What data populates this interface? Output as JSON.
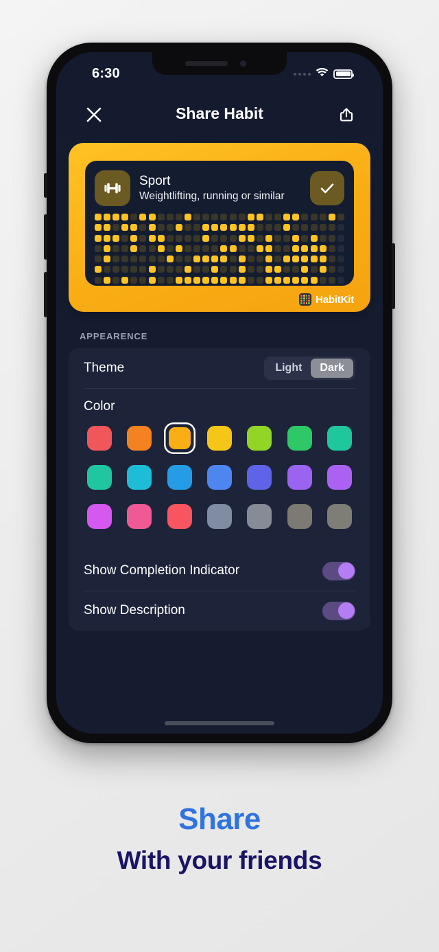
{
  "page": {
    "background_color": "#ededed"
  },
  "caption": {
    "line1": "Share",
    "line1_color": "#2f73e0",
    "line2": "With your friends",
    "line2_color": "#1a1466"
  },
  "phone": {
    "status_bar": {
      "time": "6:30",
      "signal_icon": "signal-dots-icon",
      "wifi_icon": "wifi-icon",
      "battery_icon": "battery-icon"
    },
    "nav_bar": {
      "close_icon": "close-icon",
      "title": "Share Habit",
      "share_icon": "share-icon"
    }
  },
  "preview_card": {
    "card_color": "#f9ad14",
    "habit": {
      "icon": "dumbbell-icon",
      "name": "Sport",
      "description": "Weightlifting, running or similar",
      "completion_icon": "checkmark-icon",
      "icon_bg": "#6b5a22",
      "grid_active_color": "#ffc420",
      "grid_inactive_color": "#39372a",
      "grid_rows": 7,
      "grid_columns": 28,
      "grid": [
        [
          1,
          1,
          1,
          1,
          0,
          1,
          1,
          0,
          0,
          0,
          1,
          0,
          0,
          0,
          0,
          0,
          0,
          1,
          1,
          0,
          0,
          1,
          1,
          0,
          0,
          0,
          1,
          0
        ],
        [
          1,
          1,
          0,
          1,
          1,
          0,
          1,
          0,
          0,
          1,
          0,
          0,
          1,
          1,
          1,
          1,
          1,
          1,
          0,
          0,
          0,
          1,
          0,
          0,
          0,
          0,
          0,
          0
        ],
        [
          1,
          1,
          1,
          0,
          1,
          0,
          1,
          1,
          0,
          0,
          0,
          0,
          1,
          0,
          0,
          0,
          1,
          1,
          0,
          1,
          0,
          0,
          1,
          0,
          1,
          0,
          0,
          0
        ],
        [
          0,
          1,
          0,
          0,
          1,
          0,
          0,
          1,
          0,
          1,
          0,
          0,
          0,
          0,
          1,
          1,
          0,
          0,
          1,
          1,
          0,
          0,
          1,
          1,
          1,
          1,
          0,
          0
        ],
        [
          0,
          1,
          0,
          0,
          0,
          0,
          0,
          0,
          1,
          0,
          0,
          1,
          1,
          1,
          1,
          0,
          1,
          0,
          0,
          1,
          0,
          1,
          1,
          1,
          1,
          1,
          0,
          0
        ],
        [
          1,
          0,
          0,
          0,
          0,
          0,
          1,
          0,
          0,
          0,
          1,
          0,
          0,
          1,
          0,
          0,
          1,
          0,
          0,
          1,
          1,
          0,
          0,
          1,
          0,
          1,
          0,
          0
        ],
        [
          0,
          1,
          0,
          1,
          0,
          0,
          1,
          0,
          0,
          1,
          1,
          1,
          1,
          1,
          1,
          1,
          1,
          0,
          0,
          1,
          1,
          1,
          1,
          1,
          1,
          0,
          0,
          0
        ]
      ]
    },
    "branding": {
      "name": "HabitKit",
      "logo_icon": "habitkit-grid-logo-icon"
    }
  },
  "appearance": {
    "section_label": "APPEARENCE",
    "theme": {
      "label": "Theme",
      "options": [
        "Light",
        "Dark"
      ],
      "selected": "Dark"
    },
    "color": {
      "label": "Color",
      "selected_index": 2,
      "swatches": [
        "#f0575a",
        "#f58220",
        "#f9ae13",
        "#f5c518",
        "#93d524",
        "#2fc866",
        "#1fc79c",
        "#20c6a0",
        "#1fbcd8",
        "#249ce6",
        "#4e86ef",
        "#5f63e8",
        "#9a63f0",
        "#ab62f2",
        "#d559ef",
        "#ef5a95",
        "#f85560",
        "#7f8ca1",
        "#868b96",
        "#7c7a72",
        "#7e7d76"
      ]
    },
    "completion_indicator": {
      "label": "Show Completion Indicator",
      "enabled": true
    },
    "description_toggle": {
      "label": "Show Description",
      "enabled": true
    },
    "toggle_on_color": "#b47cf5"
  }
}
